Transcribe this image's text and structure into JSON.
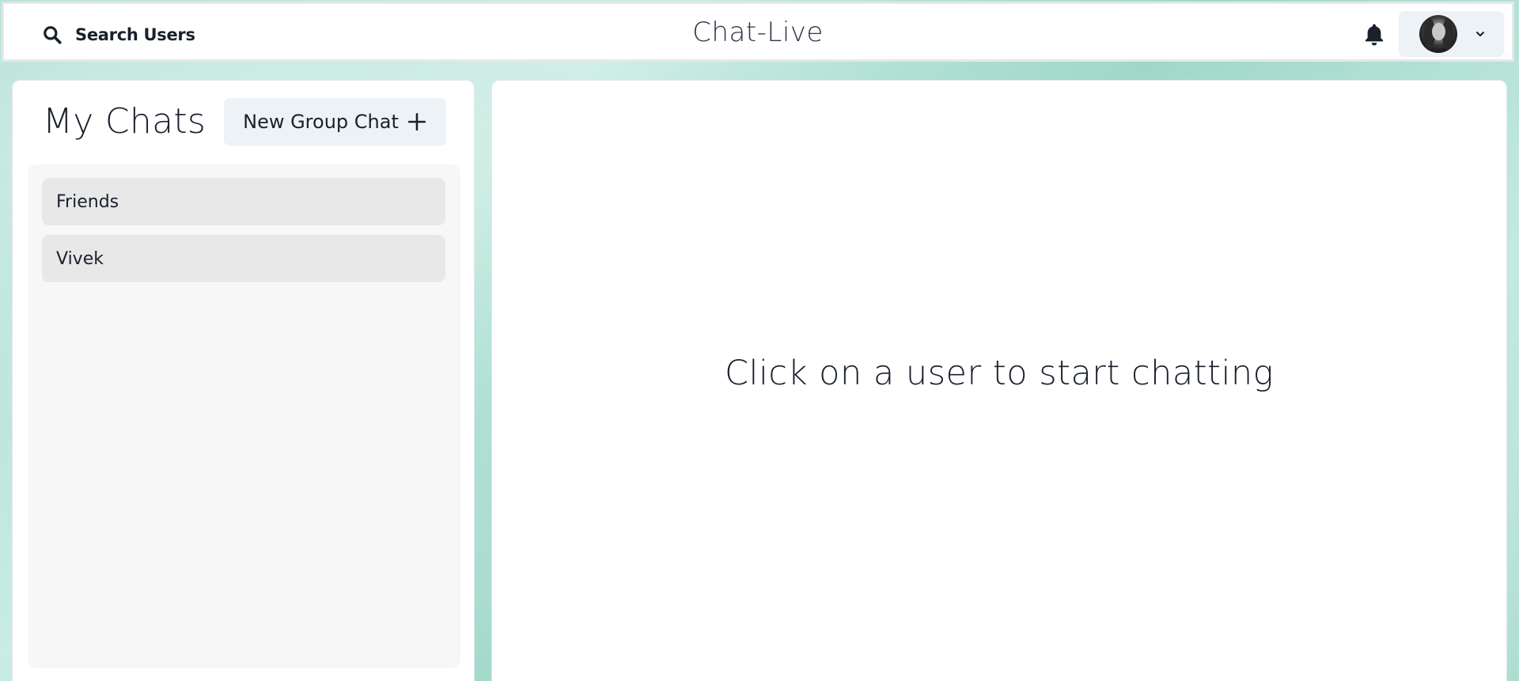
{
  "header": {
    "search_label": "Search Users",
    "app_title": "Chat-Live",
    "icons": {
      "search": "search-icon",
      "notification": "bell-icon",
      "profile_menu": "chevron-down-icon"
    }
  },
  "sidebar": {
    "title": "My Chats",
    "new_group_label": "New Group Chat",
    "chats": [
      {
        "name": "Friends"
      },
      {
        "name": "Vivek"
      }
    ]
  },
  "main": {
    "empty_message": "Click on a user to start chatting"
  },
  "colors": {
    "button_bg": "#edf2f7",
    "chat_item_bg": "#e8e8e8",
    "text": "#1a202c",
    "background_teal": "#a9dccf"
  }
}
